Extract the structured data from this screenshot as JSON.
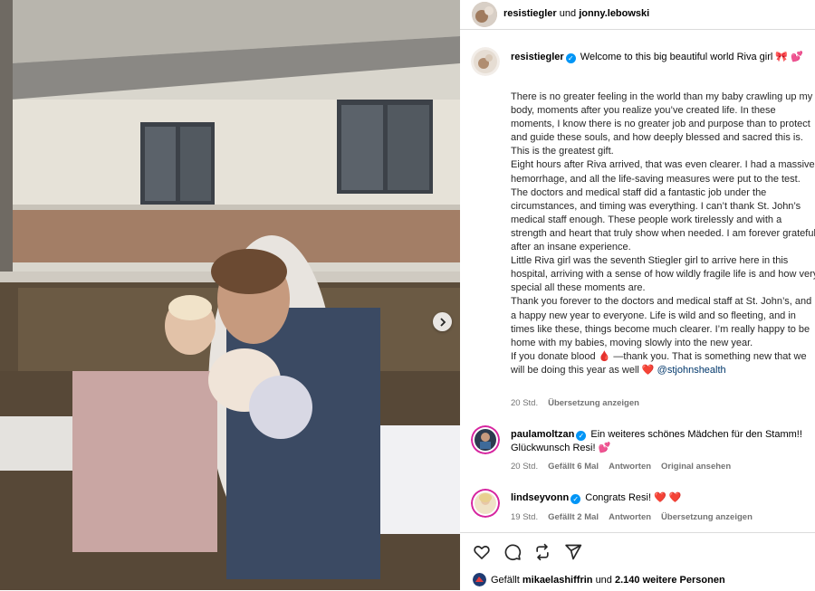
{
  "header": {
    "author": "resistiegler",
    "joiner": "und",
    "coauthor": "jonny.lebowski"
  },
  "caption": {
    "username": "resistiegler",
    "first_line": "Welcome to this big beautiful world Riva girl 🎀 💕",
    "paragraphs": [
      "There is no greater feeling in the world than my baby crawling up my body, moments after you realize you’ve created life. In these moments, I know there is no greater job and purpose than to protect and guide these souls, and how deeply blessed and sacred this is. This is the greatest gift.",
      "Eight hours after Riva arrived, that was even clearer. I had a massive hemorrhage, and all the life-saving measures were put to the test. The doctors and medical staff did a fantastic job under the circumstances, and timing was everything. I can’t thank St. John’s medical staff enough. These people work tirelessly and with a strength and heart that truly show when needed. I am forever grateful after an insane experience.",
      "Little Riva girl was the seventh Stiegler girl to arrive here in this hospital, arriving with a sense of how wildly fragile life is and how very special all these moments are.",
      "Thank you forever to the doctors and medical staff at St. John’s, and a happy new year to everyone. Life is wild and so fleeting, and in times like these, things become much clearer. I’m really happy to be home with my babies, moving slowly into the new year."
    ],
    "last_text": "If you donate blood 🩸 —thank you. That is something new that we will be doing this year as well ❤️",
    "mention": "@stjohnshealth",
    "time": "20 Std.",
    "translate": "Übersetzung anzeigen"
  },
  "comments": [
    {
      "username": "paulamoltzan",
      "text": "Ein weiteres schönes Mädchen für den Stamm!! Glückwunsch Resi! 💕",
      "time": "20 Std.",
      "likes": "Gefällt 6 Mal",
      "reply": "Antworten",
      "extra": "Original ansehen"
    },
    {
      "username": "lindseyvonn",
      "text": "Congrats Resi! ❤️ ❤️",
      "time": "19 Std.",
      "likes": "Gefällt 2 Mal",
      "reply": "Antworten",
      "extra": "Übersetzung anzeigen"
    }
  ],
  "likes_bar": {
    "prefix": "Gefällt",
    "user": "mikaelashiffrin",
    "joiner": "und",
    "others": "2.140 weitere Personen"
  },
  "icons": [
    "heart-icon",
    "comment-icon",
    "share-icon",
    "send-icon",
    "chevron-right-icon",
    "verified-badge-icon"
  ],
  "colors": {
    "accent": "#0095f6",
    "link": "#00376b",
    "muted": "#737373",
    "border": "#dbdbdb"
  }
}
